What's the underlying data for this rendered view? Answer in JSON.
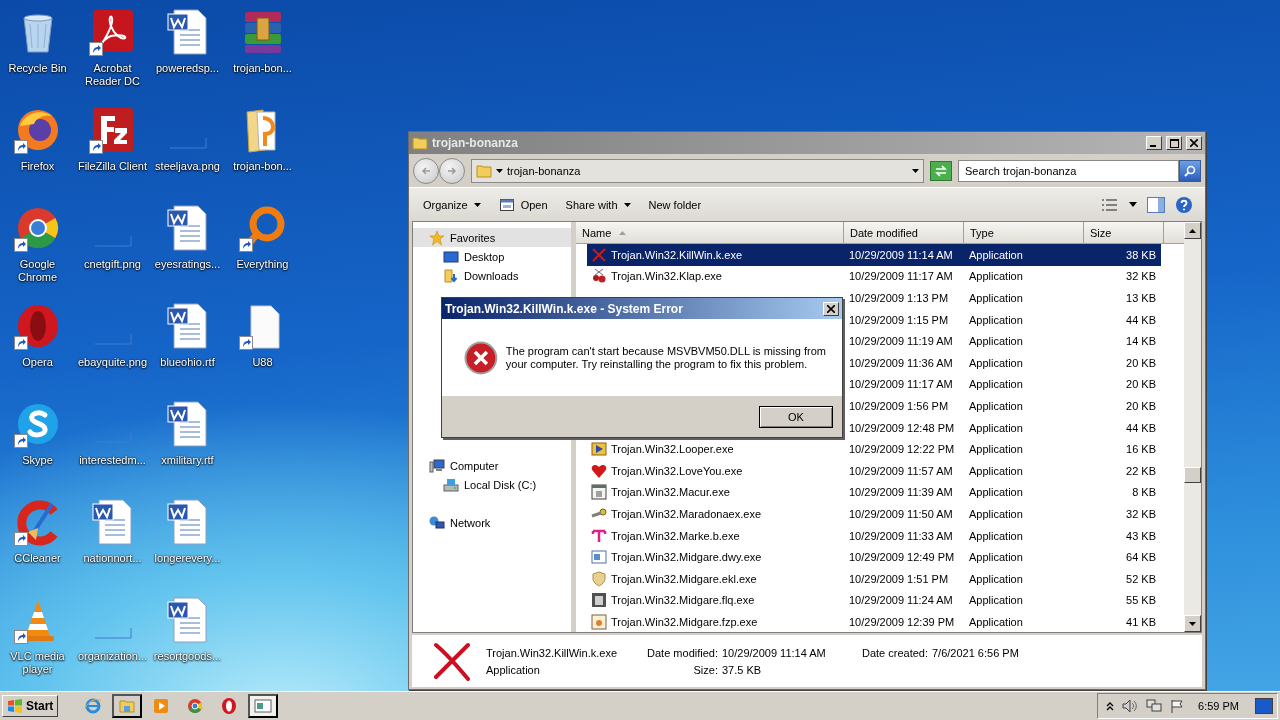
{
  "desktop_icons": [
    {
      "label": "Recycle Bin",
      "kind": "recycle",
      "shortcut": false
    },
    {
      "label": "Firefox",
      "kind": "firefox",
      "shortcut": true
    },
    {
      "label": "Google Chrome",
      "kind": "chrome",
      "shortcut": true
    },
    {
      "label": "Opera",
      "kind": "opera",
      "shortcut": true
    },
    {
      "label": "Skype",
      "kind": "skype",
      "shortcut": true
    },
    {
      "label": "CCleaner",
      "kind": "ccleaner",
      "shortcut": true
    },
    {
      "label": "VLC media player",
      "kind": "vlc",
      "shortcut": true
    },
    {
      "label": "Acrobat Reader DC",
      "kind": "pdf",
      "shortcut": true
    },
    {
      "label": "FileZilla Client",
      "kind": "filezilla",
      "shortcut": true
    },
    {
      "label": "cnetgift.png",
      "kind": "image",
      "shortcut": false
    },
    {
      "label": "ebayquite.png",
      "kind": "image",
      "shortcut": false
    },
    {
      "label": "interestedm...",
      "kind": "image",
      "shortcut": false
    },
    {
      "label": "nationnort...",
      "kind": "word",
      "shortcut": false
    },
    {
      "label": "organization...",
      "kind": "image",
      "shortcut": false
    },
    {
      "label": "poweredsp...",
      "kind": "word",
      "shortcut": false
    },
    {
      "label": "steeljava.png",
      "kind": "image",
      "shortcut": false
    },
    {
      "label": "eyesratings...",
      "kind": "word",
      "shortcut": false
    },
    {
      "label": "blueohio.rtf",
      "kind": "word",
      "shortcut": false
    },
    {
      "label": "xmilitary.rtf",
      "kind": "word",
      "shortcut": false
    },
    {
      "label": "longerevery...",
      "kind": "word",
      "shortcut": false
    },
    {
      "label": "resortgoods...",
      "kind": "word",
      "shortcut": false
    },
    {
      "label": "trojan-bon...",
      "kind": "archive",
      "shortcut": false
    },
    {
      "label": "trojan-bon...",
      "kind": "folder",
      "shortcut": false
    },
    {
      "label": "Everything",
      "kind": "everything",
      "shortcut": true
    },
    {
      "label": "U88",
      "kind": "file",
      "shortcut": true
    }
  ],
  "explorer": {
    "title": "trojan-bonanza",
    "address": "trojan-bonanza",
    "search_placeholder": "Search trojan-bonanza",
    "commands": [
      {
        "label": "Organize",
        "kind": "menu"
      },
      {
        "label": "Open",
        "kind": "open"
      },
      {
        "label": "Share with",
        "kind": "menu"
      },
      {
        "label": "New folder",
        "kind": "plain"
      }
    ],
    "nav": [
      {
        "label": "Favorites",
        "kind": "star",
        "selected": true,
        "children": [
          {
            "label": "Desktop",
            "kind": "desktop",
            "selected": false
          },
          {
            "label": "Downloads",
            "kind": "downloads",
            "selected": false
          }
        ]
      },
      {
        "label": "Computer",
        "kind": "computer",
        "selected": false,
        "children": [
          {
            "label": "Local Disk (C:)",
            "kind": "disk",
            "selected": false
          }
        ]
      },
      {
        "label": "Network",
        "kind": "network",
        "selected": false
      }
    ],
    "columns": [
      "Name",
      "Date modified",
      "Type",
      "Size"
    ],
    "files": [
      {
        "name": "Trojan.Win32.KillWin.k.exe",
        "kind": "cross",
        "date": "10/29/2009 11:14 AM",
        "type": "Application",
        "size": "38 KB",
        "selected": true
      },
      {
        "name": "Trojan.Win32.Klap.exe",
        "kind": "bugs",
        "date": "10/29/2009 11:17 AM",
        "type": "Application",
        "size": "32 KB",
        "selected": false
      },
      {
        "date": "10/29/2009 1:13 PM",
        "type": "Application",
        "size": "13 KB",
        "selected": false
      },
      {
        "date": "10/29/2009 1:15 PM",
        "type": "Application",
        "size": "44 KB",
        "selected": false
      },
      {
        "date": "10/29/2009 11:19 AM",
        "type": "Application",
        "size": "14 KB",
        "selected": false
      },
      {
        "date": "10/29/2009 11:36 AM",
        "type": "Application",
        "size": "20 KB",
        "selected": false
      },
      {
        "date": "10/29/2009 11:17 AM",
        "type": "Application",
        "size": "20 KB",
        "selected": false
      },
      {
        "date": "10/29/2009 1:56 PM",
        "type": "Application",
        "size": "20 KB",
        "selected": false
      },
      {
        "date": "10/29/2009 12:48 PM",
        "type": "Application",
        "size": "44 KB",
        "selected": false
      },
      {
        "name": "Trojan.Win32.Looper.exe",
        "kind": "play",
        "date": "10/29/2009 12:22 PM",
        "type": "Application",
        "size": "16 KB",
        "selected": false
      },
      {
        "name": "Trojan.Win32.LoveYou.exe",
        "kind": "heart",
        "date": "10/29/2009 11:57 AM",
        "type": "Application",
        "size": "22 KB",
        "selected": false
      },
      {
        "name": "Trojan.Win32.Macur.exe",
        "kind": "window",
        "date": "10/29/2009 11:39 AM",
        "type": "Application",
        "size": "8 KB",
        "selected": false
      },
      {
        "name": "Trojan.Win32.Maradonaex.exe",
        "kind": "key",
        "date": "10/29/2009 11:50 AM",
        "type": "Application",
        "size": "32 KB",
        "selected": false
      },
      {
        "name": "Trojan.Win32.Marke.b.exe",
        "kind": "tee",
        "date": "10/29/2009 11:33 AM",
        "type": "Application",
        "size": "43 KB",
        "selected": false
      },
      {
        "name": "Trojan.Win32.Midgare.dwy.exe",
        "kind": "dialog",
        "date": "10/29/2009 12:49 PM",
        "type": "Application",
        "size": "64 KB",
        "selected": false
      },
      {
        "name": "Trojan.Win32.Midgare.ekl.exe",
        "kind": "shield",
        "date": "10/29/2009 1:51 PM",
        "type": "Application",
        "size": "52 KB",
        "selected": false
      },
      {
        "name": "Trojan.Win32.Midgare.flq.exe",
        "kind": "photo",
        "date": "10/29/2009 11:24 AM",
        "type": "Application",
        "size": "55 KB",
        "selected": false
      },
      {
        "name": "Trojan.Win32.Midgare.fzp.exe",
        "kind": "app",
        "date": "10/29/2009 12:39 PM",
        "type": "Application",
        "size": "41 KB",
        "selected": false
      }
    ],
    "details": {
      "name": "Trojan.Win32.KillWin.k.exe",
      "type": "Application",
      "modified_label": "Date modified:",
      "modified": "10/29/2009 11:14 AM",
      "size_label": "Size:",
      "size": "37.5 KB",
      "created_label": "Date created:",
      "created": "7/6/2021 6:56 PM"
    }
  },
  "dialog": {
    "title": "Trojan.Win32.KillWin.k.exe - System Error",
    "message": "The program can't start because MSVBVM50.DLL is missing from your computer. Try reinstalling the program to fix this problem.",
    "button": "OK"
  },
  "taskbar": {
    "start": "Start",
    "apps": [
      {
        "kind": "ie",
        "running": false,
        "active": false
      },
      {
        "kind": "explorer",
        "running": true,
        "active": false
      },
      {
        "kind": "player",
        "running": false,
        "active": false
      },
      {
        "kind": "chrome",
        "running": false,
        "active": false
      },
      {
        "kind": "opera",
        "running": false,
        "active": false
      },
      {
        "kind": "window",
        "running": true,
        "active": true
      }
    ],
    "clock": "6:59 PM"
  }
}
